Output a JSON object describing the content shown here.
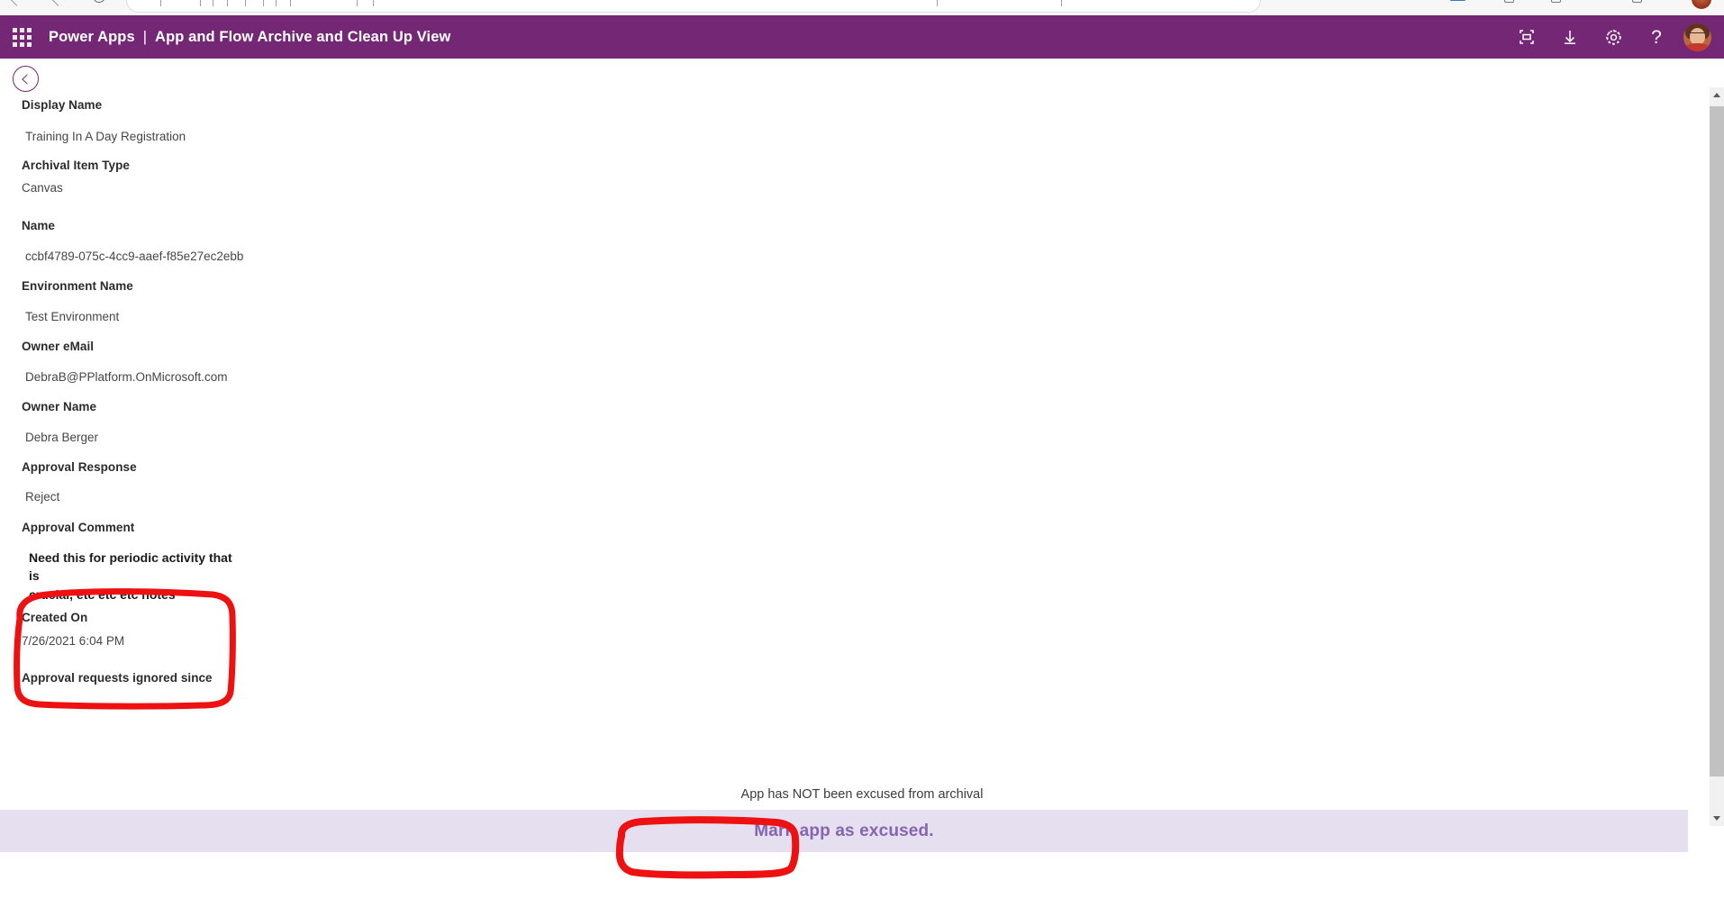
{
  "window": {
    "title": "Power Apps | App and Flow Archive and Clean Up View"
  },
  "browser_chrome": {
    "visible": "partial"
  },
  "header": {
    "waffle_label": "app-launcher",
    "brand": "Power Apps",
    "separator": "|",
    "app_title": "App and Flow Archive and Clean Up View",
    "icons": [
      {
        "name": "fit-to-screen-icon",
        "label": "Fit to screen"
      },
      {
        "name": "download-icon",
        "label": "Download"
      },
      {
        "name": "settings-gear-icon",
        "label": "Settings"
      },
      {
        "name": "help-icon",
        "label": "?"
      }
    ],
    "avatar_label": "User account"
  },
  "back_button": {
    "label": "Back"
  },
  "form": {
    "fields": [
      {
        "label": "Display Name",
        "value": "Training In A Day Registration"
      },
      {
        "label": "Archival Item Type",
        "value": "Canvas"
      },
      {
        "label": "Name",
        "value": "ccbf4789-075c-4cc9-aaef-f85e27ec2ebb"
      },
      {
        "label": "Environment Name",
        "value": "Test Environment"
      },
      {
        "label": "Owner eMail",
        "value": "DebraB@PPlatform.OnMicrosoft.com"
      },
      {
        "label": "Owner Name",
        "value": "Debra Berger"
      },
      {
        "label": "Approval Response",
        "value": "Reject"
      },
      {
        "label": "Approval Comment",
        "value": "Need this for periodic activity that is\ncrucial, etc etc etc notes"
      },
      {
        "label": "Created On",
        "value": "7/26/2021 6:04 PM"
      },
      {
        "label": "Approval requests ignored since",
        "value": ""
      }
    ]
  },
  "footer": {
    "status_text": "App has NOT been excused from archival",
    "action_label": "Mark app as excused."
  },
  "scrollbar": {
    "orientation": "vertical",
    "up_label": "Scroll up",
    "down_label": "Scroll down"
  },
  "annotations": [
    {
      "name": "approval-comment-highlight",
      "color": "#ee1111"
    },
    {
      "name": "mark-app-excused-highlight",
      "color": "#ee1111"
    }
  ],
  "colors": {
    "header_purple": "#742774",
    "action_band": "#e5dff0",
    "action_text": "#8465b0",
    "annotation_red": "#ee1111"
  }
}
